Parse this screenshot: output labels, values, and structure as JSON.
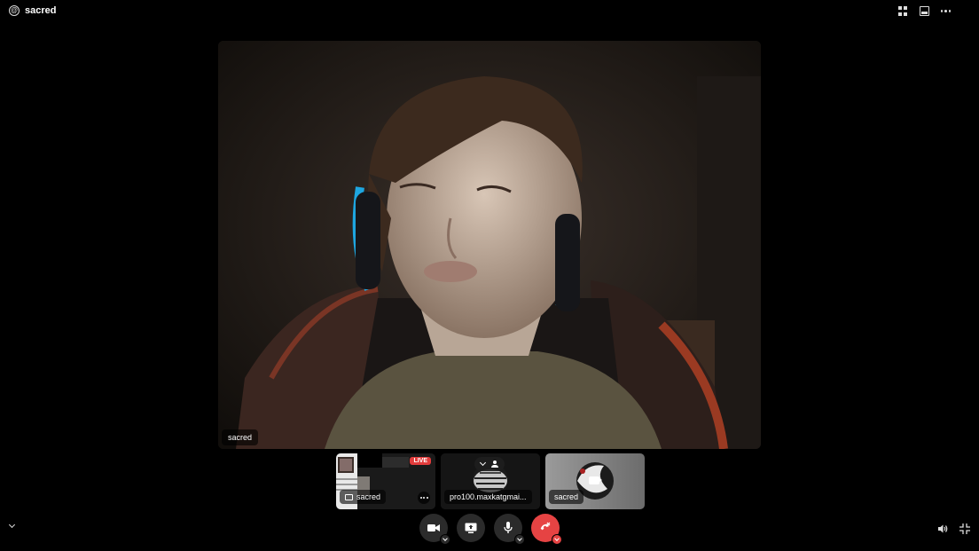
{
  "header": {
    "channel_icon": "at-icon",
    "title": "sacred",
    "actions": [
      "grid-layout-icon",
      "inbox-icon",
      "more-icon"
    ]
  },
  "main_stream": {
    "participant_name": "sacred"
  },
  "tiles": [
    {
      "name": "sacred",
      "badge": "LIVE",
      "type": "screen-share"
    },
    {
      "name": "pro100.maxkatgmai...",
      "type": "avatar"
    },
    {
      "name": "sacred",
      "type": "camera-off"
    }
  ],
  "controls": [
    {
      "name": "camera-button",
      "icon": "video-camera-icon"
    },
    {
      "name": "screen-share-button",
      "icon": "screen-share-icon"
    },
    {
      "name": "microphone-button",
      "icon": "microphone-icon"
    },
    {
      "name": "leave-call-button",
      "icon": "phone-hangup-icon",
      "color": "#e64343"
    }
  ],
  "footer": {
    "left_icon": "chevron-down-icon",
    "right_icons": [
      "volume-icon",
      "exit-fullscreen-icon"
    ]
  }
}
